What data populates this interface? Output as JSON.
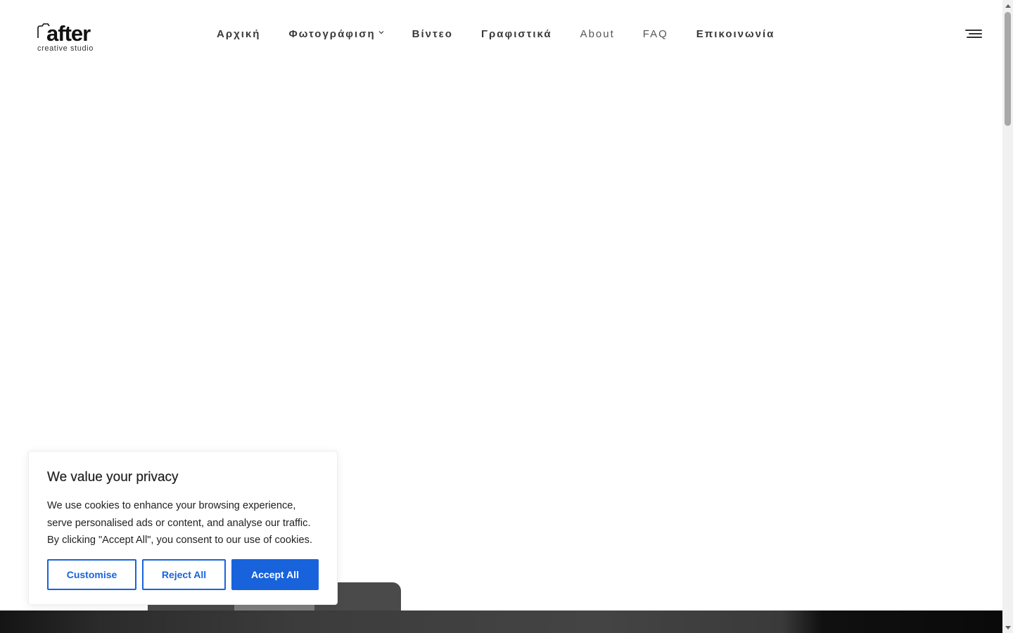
{
  "logo": {
    "word": "after",
    "subtitle": "creative studio"
  },
  "nav": {
    "items": [
      {
        "label": "Αρχική"
      },
      {
        "label": "Φωτογράφιση"
      },
      {
        "label": "Βίντεο"
      },
      {
        "label": "Γραφιστικά"
      },
      {
        "label": "About"
      },
      {
        "label": "FAQ"
      },
      {
        "label": "Επικοινωνία"
      }
    ]
  },
  "cookie_banner": {
    "title": "We value your privacy",
    "text": "We use cookies to enhance your browsing experience, serve personalised ads or content, and analyse our traffic. By clicking \"Accept All\", you consent to our use of cookies.",
    "customise_label": "Customise",
    "reject_label": "Reject All",
    "accept_label": "Accept All"
  },
  "colors": {
    "accent": "#1863dc",
    "nav_text": "#3a3a3a",
    "text": "#212121"
  },
  "icons": {
    "menu": "hamburger-icon",
    "dropdown": "chevron-down-icon",
    "scroll_up": "triangle-up-icon",
    "scroll_down": "triangle-down-icon"
  }
}
